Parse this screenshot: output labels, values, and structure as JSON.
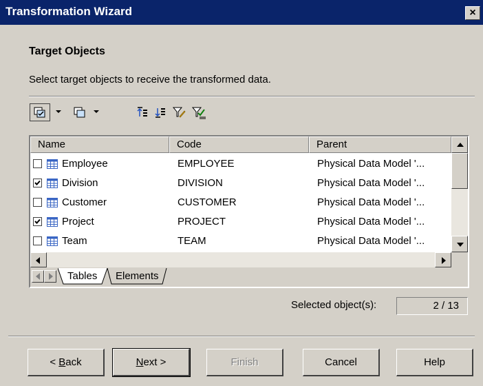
{
  "window": {
    "title": "Transformation Wizard",
    "close_label": "×"
  },
  "page": {
    "heading": "Target Objects",
    "instruction": "Select target objects to receive the transformed data."
  },
  "toolbar": {
    "icons": [
      "select-all-icon",
      "deselect-all-icon",
      "move-to-top-icon",
      "move-to-bottom-icon",
      "filter-icon",
      "filter-selected-icon"
    ]
  },
  "table": {
    "columns": [
      "Name",
      "Code",
      "Parent"
    ],
    "rows": [
      {
        "name": "Employee",
        "code": "EMPLOYEE",
        "parent": "Physical Data Model '...",
        "checked": false
      },
      {
        "name": "Division",
        "code": "DIVISION",
        "parent": "Physical Data Model '...",
        "checked": true
      },
      {
        "name": "Customer",
        "code": "CUSTOMER",
        "parent": "Physical Data Model '...",
        "checked": false
      },
      {
        "name": "Project",
        "code": "PROJECT",
        "parent": "Physical Data Model '...",
        "checked": true
      },
      {
        "name": "Team",
        "code": "TEAM",
        "parent": "Physical Data Model '...",
        "checked": false
      }
    ]
  },
  "tabs": [
    {
      "label": "Tables",
      "active": true
    },
    {
      "label": "Elements",
      "active": false
    }
  ],
  "selection": {
    "label": "Selected object(s):",
    "count": "2 / 13"
  },
  "buttons": {
    "back": {
      "pre": "< ",
      "mnemonic": "B",
      "rest": "ack"
    },
    "next": {
      "mnemonic": "N",
      "rest": "ext >"
    },
    "finish": "Finish",
    "cancel": "Cancel",
    "help": "Help"
  },
  "colors": {
    "titlebar": "#0a246a",
    "dialog_bg": "#d4d0c8",
    "table_icon": "#3a66c4"
  }
}
